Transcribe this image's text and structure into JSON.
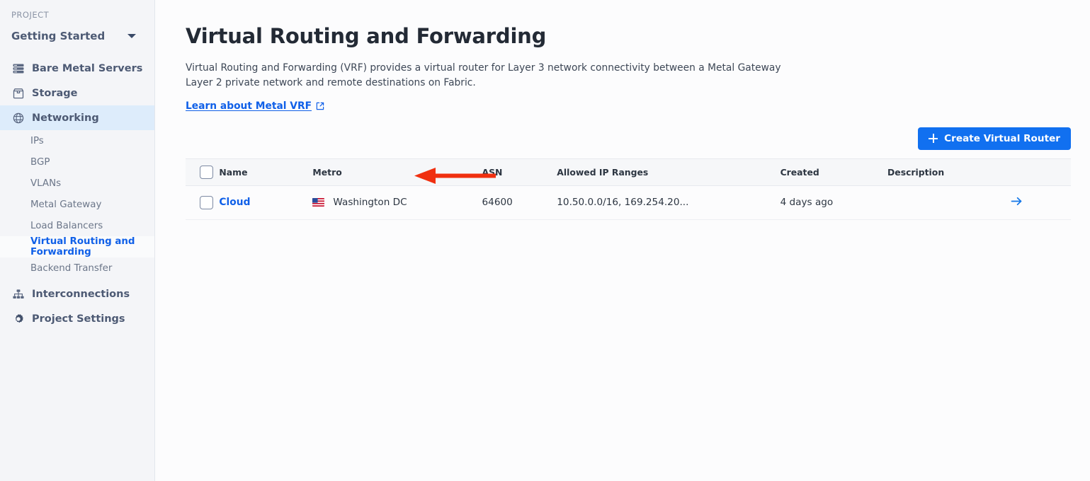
{
  "sidebar": {
    "project_label": "PROJECT",
    "project_name": "Getting Started",
    "caret_icon": "chevron-down-icon",
    "items": [
      {
        "label": "Bare Metal Servers",
        "icon": "server-icon",
        "active": false
      },
      {
        "label": "Storage",
        "icon": "storage-box-icon",
        "active": false
      },
      {
        "label": "Networking",
        "icon": "globe-icon",
        "active": true
      }
    ],
    "sub_items": [
      {
        "label": "IPs",
        "active": false
      },
      {
        "label": "BGP",
        "active": false
      },
      {
        "label": "VLANs",
        "active": false
      },
      {
        "label": "Metal Gateway",
        "active": false
      },
      {
        "label": "Load Balancers",
        "active": false
      },
      {
        "label": "Virtual Routing and Forwarding",
        "active": true
      },
      {
        "label": "Backend Transfer",
        "active": false
      }
    ],
    "bottom_items": [
      {
        "label": "Interconnections",
        "icon": "hierarchy-icon"
      },
      {
        "label": "Project Settings",
        "icon": "gear-icon"
      }
    ]
  },
  "main": {
    "title": "Virtual Routing and Forwarding",
    "description": "Virtual Routing and Forwarding (VRF) provides a virtual router for Layer 3 network connectivity between a Metal Gateway Layer 2 private network and remote destinations on Fabric.",
    "learn_link": "Learn about Metal VRF",
    "learn_link_icon": "external-link-icon",
    "create_button": "Create Virtual Router",
    "create_button_icon": "plus-icon"
  },
  "table": {
    "columns": [
      "Name",
      "Metro",
      "ASN",
      "Allowed IP Ranges",
      "Created",
      "Description"
    ],
    "select_all_checkbox": "select-all-checkbox",
    "rows": [
      {
        "checkbox": "row-checkbox",
        "name": "Cloud",
        "metro_flag": "us-flag-icon",
        "metro": "Washington DC",
        "asn": "64600",
        "allowed_ip_ranges": "10.50.0.0/16, 169.254.20...",
        "created": "4 days ago",
        "description": "",
        "go_icon": "arrow-right-icon"
      }
    ]
  },
  "annotation": {
    "type": "arrow-pointing-left",
    "color": "#f03010",
    "target": "Cloud"
  },
  "colors": {
    "accent": "#1170f0",
    "link": "#1060e8",
    "sidebar_bg": "#f4f5f8",
    "active_nav_bg": "#ddecfb",
    "annotation_red": "#f03010"
  }
}
